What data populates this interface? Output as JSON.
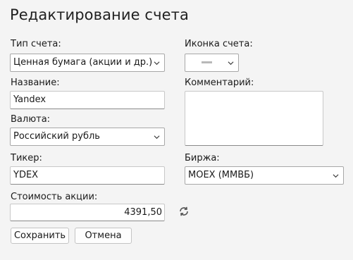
{
  "header": {
    "title": "Редактирование счета"
  },
  "form": {
    "account_type": {
      "label": "Тип счета:",
      "value": "Ценная бумага (акции и др.)"
    },
    "account_icon": {
      "label": "Иконка счета:"
    },
    "name": {
      "label": "Название:",
      "value": "Yandex"
    },
    "comment": {
      "label": "Комментарий:",
      "value": ""
    },
    "currency": {
      "label": "Валюта:",
      "value": "Российский рубль"
    },
    "ticker": {
      "label": "Тикер:",
      "value": "YDEX"
    },
    "exchange": {
      "label": "Биржа:",
      "value": "MOEX (ММВБ)"
    },
    "share_price": {
      "label": "Стоимость акции:",
      "value": "4391,50"
    }
  },
  "actions": {
    "save_label": "Сохранить",
    "cancel_label": "Отмена"
  },
  "colors": {
    "background": "#f4f4f4",
    "field_background": "#ffffff",
    "border": "#c8c8c8",
    "icon_swatch": "#b8b8b8"
  },
  "icons": {
    "dropdown": "chevron-down-icon",
    "refresh": "refresh-icon"
  }
}
